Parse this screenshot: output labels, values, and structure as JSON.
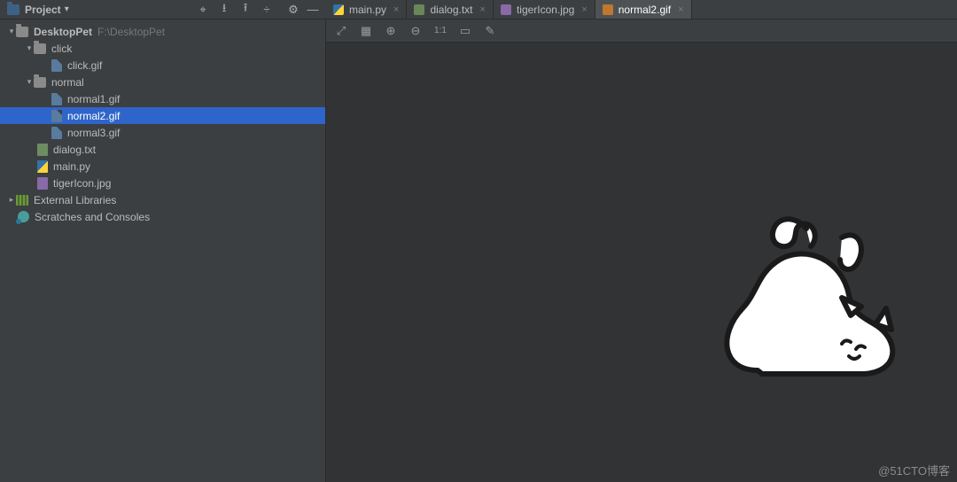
{
  "header": {
    "project_label": "Project",
    "dropdown_glyph": "▾",
    "tool_icons": [
      "⌖",
      "⭳",
      "⭱",
      "÷"
    ],
    "gear_glyph": "⚙",
    "collapse_glyph": "—"
  },
  "tabs": [
    {
      "name": "main.py",
      "icon": "ic-py",
      "active": false
    },
    {
      "name": "dialog.txt",
      "icon": "ic-txt",
      "active": false
    },
    {
      "name": "tigerIcon.jpg",
      "icon": "ic-jpg",
      "active": false
    },
    {
      "name": "normal2.gif",
      "icon": "ic-gif",
      "active": true
    }
  ],
  "tree": {
    "root": {
      "name": "DesktopPet",
      "path_hint": "F:\\DesktopPet"
    },
    "click_folder": "click",
    "click_file": "click.gif",
    "normal_folder": "normal",
    "normal_files": [
      "normal1.gif",
      "normal2.gif",
      "normal3.gif"
    ],
    "selected": "normal2.gif",
    "other_files": {
      "dialog": "dialog.txt",
      "main": "main.py",
      "tiger": "tigerIcon.jpg"
    },
    "external_libs": "External Libraries",
    "scratches": "Scratches and Consoles"
  },
  "viewer": {
    "toolbar_icons": [
      "⤢",
      "▦",
      "⊕",
      "⊖",
      "1:1",
      "▭",
      "✎"
    ]
  },
  "watermark": "@51CTO博客"
}
